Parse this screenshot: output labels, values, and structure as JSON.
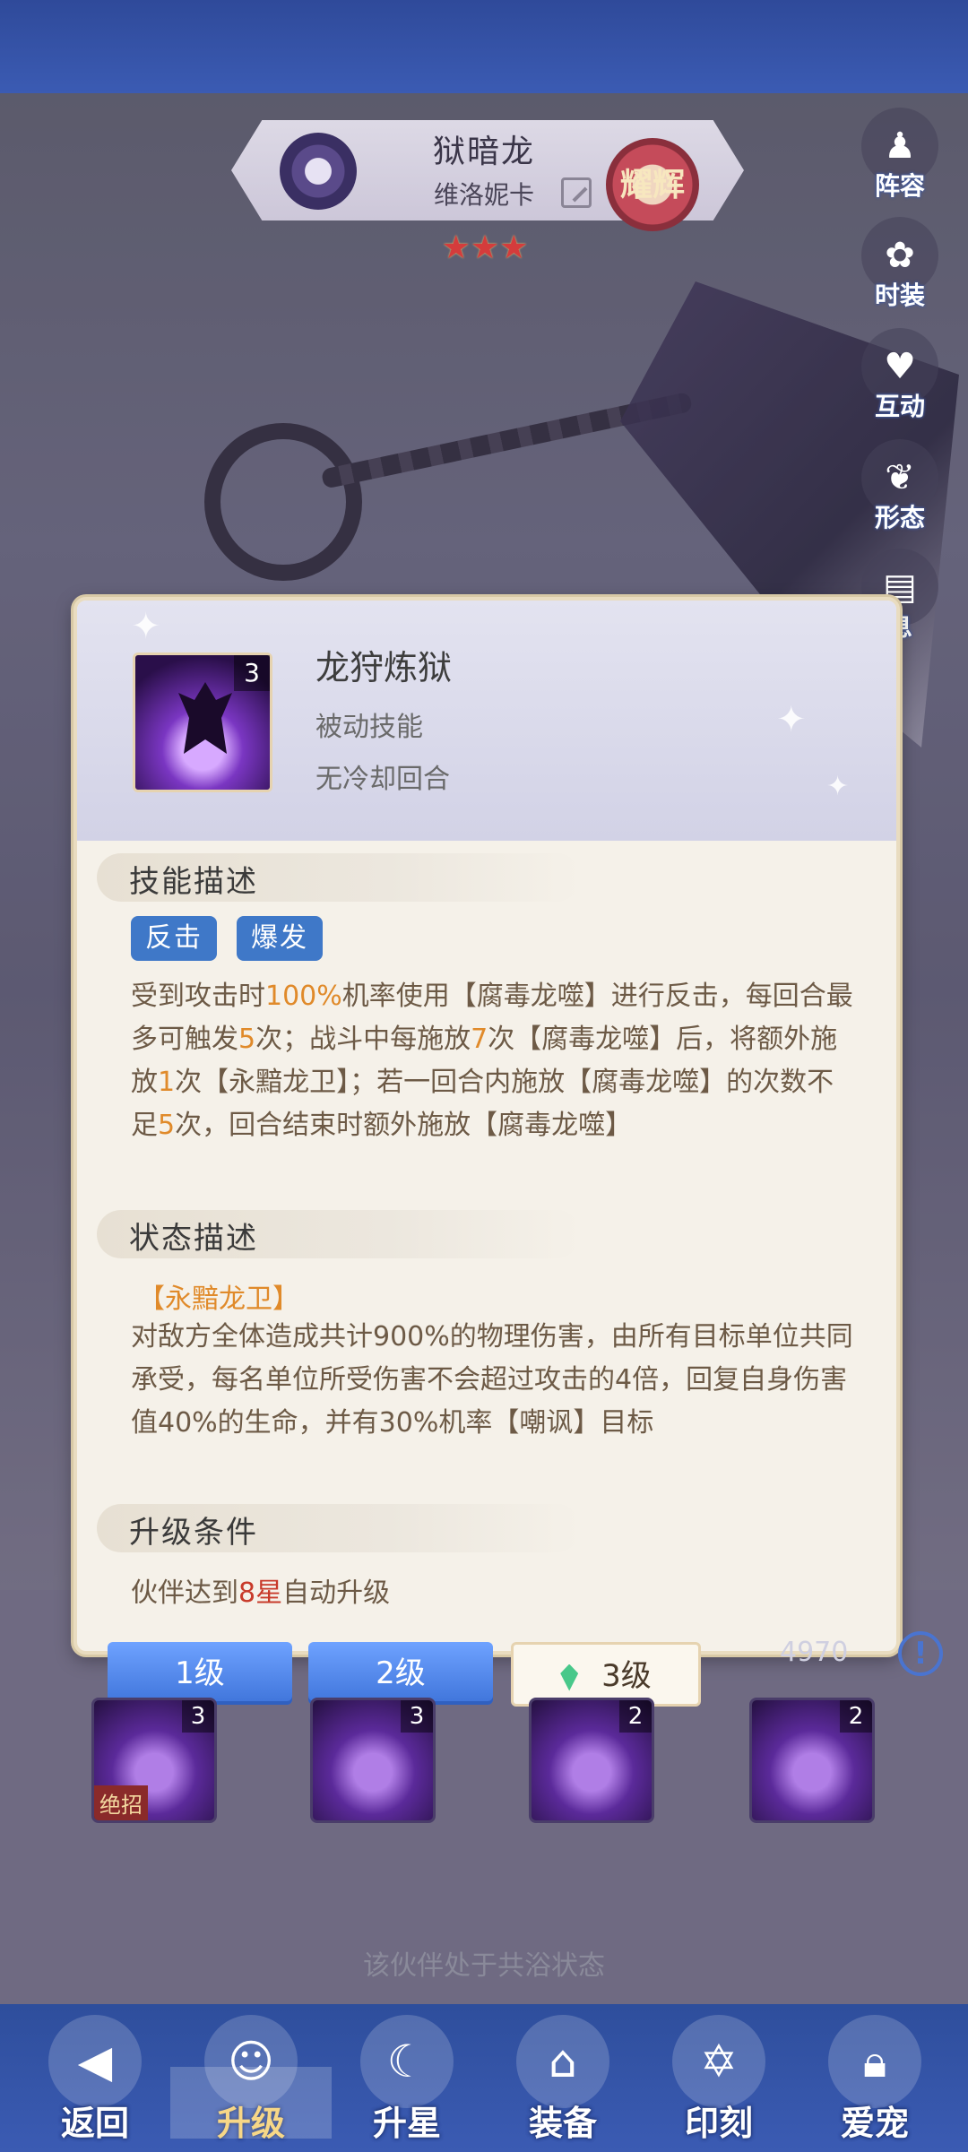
{
  "hero": {
    "name": "狱暗龙",
    "subtitle": "维洛妮卡",
    "badge": "耀辉",
    "stars": 3
  },
  "side_menu": [
    {
      "label": "阵容",
      "icon": "pawn-icon"
    },
    {
      "label": "时装",
      "icon": "outfit-icon"
    },
    {
      "label": "互动",
      "icon": "heart-icon"
    },
    {
      "label": "形态",
      "icon": "butterfly-icon"
    },
    {
      "label": "息",
      "icon": "book-icon"
    }
  ],
  "skill": {
    "name": "龙狩炼狱",
    "type": "被动技能",
    "cooldown": "无冷却回合",
    "level_badge": "3",
    "sections": {
      "description_title": "技能描述",
      "status_title": "状态描述",
      "upgrade_title": "升级条件"
    },
    "tags": [
      "反击",
      "爆发"
    ],
    "effect_name": "【永黯龙卫】",
    "upgrade_text_prefix": "伙伴达到",
    "upgrade_text_highlight": "8星",
    "upgrade_text_suffix": "自动升级"
  },
  "level_tabs": [
    "1级",
    "2级",
    "3级"
  ],
  "skill_icons": [
    {
      "num": "3",
      "ult_label": "绝招"
    },
    {
      "num": "3"
    },
    {
      "num": "2"
    },
    {
      "num": "2"
    }
  ],
  "coin_count": "4970",
  "status_text": "该伙伴处于共浴状态",
  "bottom_nav": [
    {
      "label": "返回",
      "icon": "back-icon"
    },
    {
      "label": "升级",
      "icon": "portrait-icon"
    },
    {
      "label": "升星",
      "icon": "moon-star-icon"
    },
    {
      "label": "装备",
      "icon": "hat-icon"
    },
    {
      "label": "印刻",
      "icon": "hexagram-icon"
    },
    {
      "label": "爱宠",
      "icon": "lock-icon"
    }
  ],
  "colors": {
    "accent_orange": "#e08a2a",
    "accent_red": "#c83a2a",
    "tag_blue": "#3f78c8",
    "nav_blue": "#3b5bb3"
  }
}
